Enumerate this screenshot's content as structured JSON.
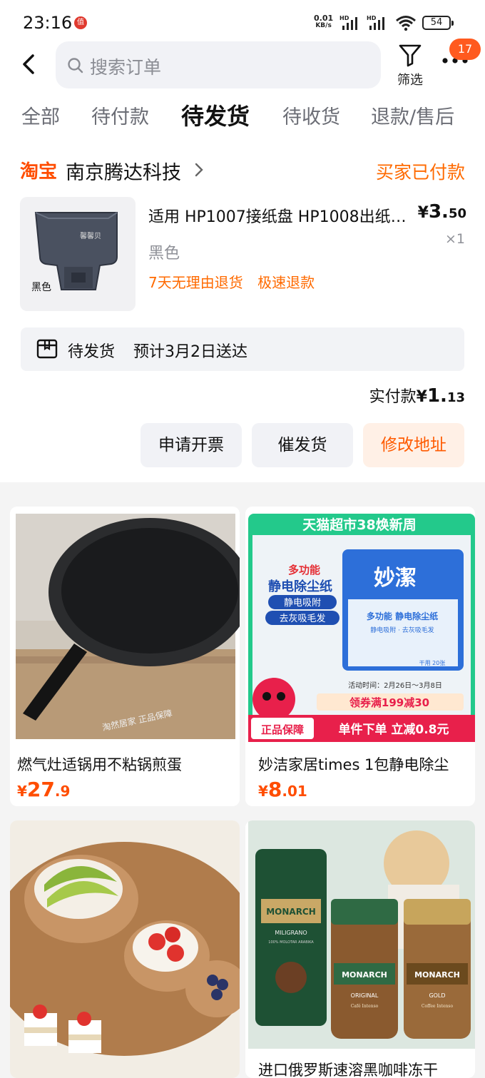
{
  "status_bar": {
    "time": "23:16",
    "notif_icon": "值",
    "net_speed_value": "0.01",
    "net_speed_unit": "KB/s",
    "hd1": "HD",
    "hd2": "HD",
    "battery": "54"
  },
  "search": {
    "placeholder": "搜索订单"
  },
  "filter_label": "筛选",
  "more_badge": "17",
  "tabs": [
    {
      "label": "全部",
      "active": false
    },
    {
      "label": "待付款",
      "active": false
    },
    {
      "label": "待发货",
      "active": true
    },
    {
      "label": "待收货",
      "active": false
    },
    {
      "label": "退款/售后",
      "active": false
    }
  ],
  "order": {
    "platform": "淘宝",
    "shop_name": "南京腾达科技",
    "status": "买家已付款",
    "product": {
      "title": "适用 HP1007接纸盘 HP1008出纸…",
      "spec": "黑色",
      "price_symbol": "¥",
      "price_int": "3.",
      "price_dec": "50",
      "qty": "×1",
      "tags": [
        "7天无理由退货",
        "极速退款"
      ],
      "image_label": "黑色",
      "image_brand": "馨馨贝"
    },
    "shipping_status": "待发货",
    "shipping_eta": "预计3月2日送达",
    "paid_label": "实付款",
    "paid_symbol": "¥",
    "paid_int": "1.",
    "paid_dec": "13",
    "buttons": [
      "申请开票",
      "催发货",
      "修改地址"
    ]
  },
  "recommendations": [
    {
      "title": "燃气灶适锅用不粘锅煎蛋",
      "symbol": "¥",
      "int": "27",
      "dec": ".9",
      "img_caption": "淘然居家   正品保障"
    },
    {
      "title": "妙洁家居times 1包静电除尘",
      "symbol": "¥",
      "int": "8",
      "dec": ".01",
      "banner_top": "天猫超市38焕新周",
      "feature_title": "多功能",
      "feature_main": "静电除尘纸",
      "feature_tag1": "静电吸附",
      "feature_tag2": "去灰吸毛发",
      "brand": "妙潔",
      "pack_text": "多功能 静电除尘纸",
      "pack_sub": "静电吸附 · 去灰吸毛发",
      "pack_count": "干用 20张",
      "promo_date": "活动时间：2月26日～3月8日",
      "coupon": "领券满199减30",
      "badge": "正品保障",
      "bottom": "单件下单 立减0.8元"
    },
    {
      "title": "",
      "symbol": "",
      "int": "",
      "dec": ""
    },
    {
      "title": "进口俄罗斯速溶黑咖啡冻干",
      "symbol": "",
      "int": "",
      "dec": "",
      "brand": "MONARCH",
      "variant1": "MILIGRANO",
      "variant2": "ORIGINAL",
      "variant3": "GOLD",
      "sub1": "100% MOLOTAR ARABIKA",
      "sub2": "Café Intenso",
      "sub3": "Coffee Intenso"
    }
  ],
  "colors": {
    "accent": "#ff5a00",
    "tmall_red": "#e8204b",
    "page_bg": "#f4f4f4"
  }
}
